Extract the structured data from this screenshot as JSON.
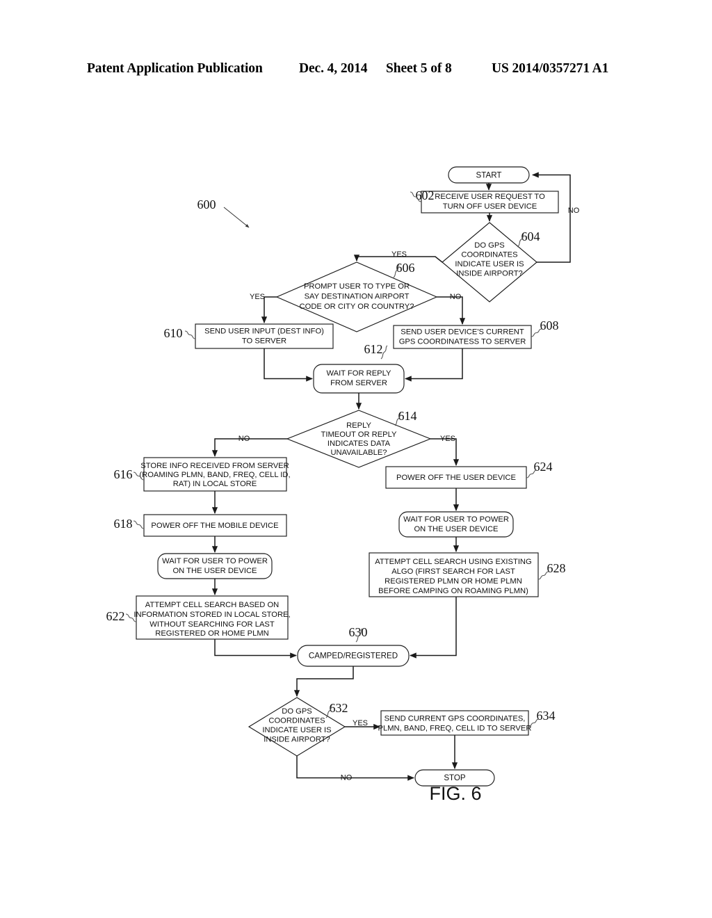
{
  "header": {
    "publication": "Patent Application Publication",
    "date": "Dec. 4, 2014",
    "sheet": "Sheet 5 of 8",
    "patent_number": "US 2014/0357271 A1"
  },
  "figure": {
    "label": "FIG. 6",
    "diagram_ref": "600",
    "type": "flowchart",
    "title": ""
  },
  "nodes": {
    "start": {
      "ref": "",
      "shape": "terminator",
      "text": "START"
    },
    "n602": {
      "ref": "602",
      "shape": "process",
      "line1": "RECEIVE USER REQUEST TO",
      "line2": "TURN OFF USER DEVICE"
    },
    "n604": {
      "ref": "604",
      "shape": "decision",
      "line1": "DO GPS",
      "line2": "COORDINATES",
      "line3": "INDICATE USER IS",
      "line4": "INSIDE AIRPORT?"
    },
    "n606": {
      "ref": "606",
      "shape": "decision",
      "line1": "PROMPT USER TO TYPE OR",
      "line2": "SAY DESTINATION AIRPORT",
      "line3": "CODE OR CITY OR COUNTRY?"
    },
    "n608": {
      "ref": "608",
      "shape": "process",
      "line1": "SEND USER DEVICE'S CURRENT",
      "line2": "GPS COORDINATESS TO SERVER"
    },
    "n610": {
      "ref": "610",
      "shape": "process",
      "line1": "SEND USER INPUT (DEST INFO)",
      "line2": "TO SERVER"
    },
    "n612": {
      "ref": "612",
      "shape": "terminator",
      "line1": "WAIT FOR REPLY",
      "line2": "FROM SERVER"
    },
    "n614": {
      "ref": "614",
      "shape": "decision",
      "line1": "REPLY",
      "line2": "TIMEOUT OR REPLY",
      "line3": "INDICATES DATA",
      "line4": "UNAVAILABLE?"
    },
    "n616": {
      "ref": "616",
      "shape": "process",
      "line1": "STORE INFO RECEIVED FROM SERVER",
      "line2": "(ROAMING PLMN, BAND, FREQ, CELL ID,",
      "line3": "RAT) IN LOCAL STORE"
    },
    "n618": {
      "ref": "618",
      "shape": "process",
      "line1": "POWER OFF THE MOBILE DEVICE"
    },
    "n620": {
      "ref": "",
      "shape": "terminator",
      "line1": "WAIT FOR USER TO POWER",
      "line2": "ON  THE USER DEVICE"
    },
    "n622": {
      "ref": "622",
      "shape": "process",
      "line1": "ATTEMPT CELL SEARCH BASED ON",
      "line2": "INFORMATION STORED IN LOCAL STORE,",
      "line3": "WITHOUT SEARCHING FOR  LAST",
      "line4": "REGISTERED OR HOME PLMN"
    },
    "n624": {
      "ref": "624",
      "shape": "process",
      "line1": "POWER OFF THE USER DEVICE"
    },
    "n626": {
      "ref": "",
      "shape": "terminator",
      "line1": "WAIT FOR USER TO POWER",
      "line2": "ON  THE USER DEVICE"
    },
    "n628": {
      "ref": "628",
      "shape": "process",
      "line1": "ATTEMPT CELL SEARCH USING EXISTING",
      "line2": "ALGO (FIRST SEARCH FOR LAST",
      "line3": "REGISTERED PLMN OR HOME PLMN",
      "line4": "BEFORE CAMPING ON ROAMING PLMN)"
    },
    "n630": {
      "ref": "630",
      "shape": "terminator",
      "text": "CAMPED/REGISTERED"
    },
    "n632": {
      "ref": "632",
      "shape": "decision",
      "line1": "DO GPS",
      "line2": "COORDINATES",
      "line3": "INDICATE USER IS",
      "line4": "INSIDE AIRPORT?"
    },
    "n634": {
      "ref": "634",
      "shape": "process",
      "line1": "SEND CURRENT GPS COORDINATES,",
      "line2": "PLMN, BAND, FREQ, CELL ID TO SERVER"
    },
    "stop": {
      "ref": "",
      "shape": "terminator",
      "text": "STOP"
    }
  },
  "edge_labels": {
    "e604_yes": "YES",
    "e604_no": "NO",
    "e606_yes": "YES",
    "e606_no": "NO",
    "e614_no": "NO",
    "e614_yes": "YES",
    "e632_yes": "YES",
    "e632_no": "NO"
  },
  "colors": {
    "stroke": "#1a1a1a",
    "fill": "#ffffff",
    "text": "#111111",
    "leader": "#555555"
  }
}
